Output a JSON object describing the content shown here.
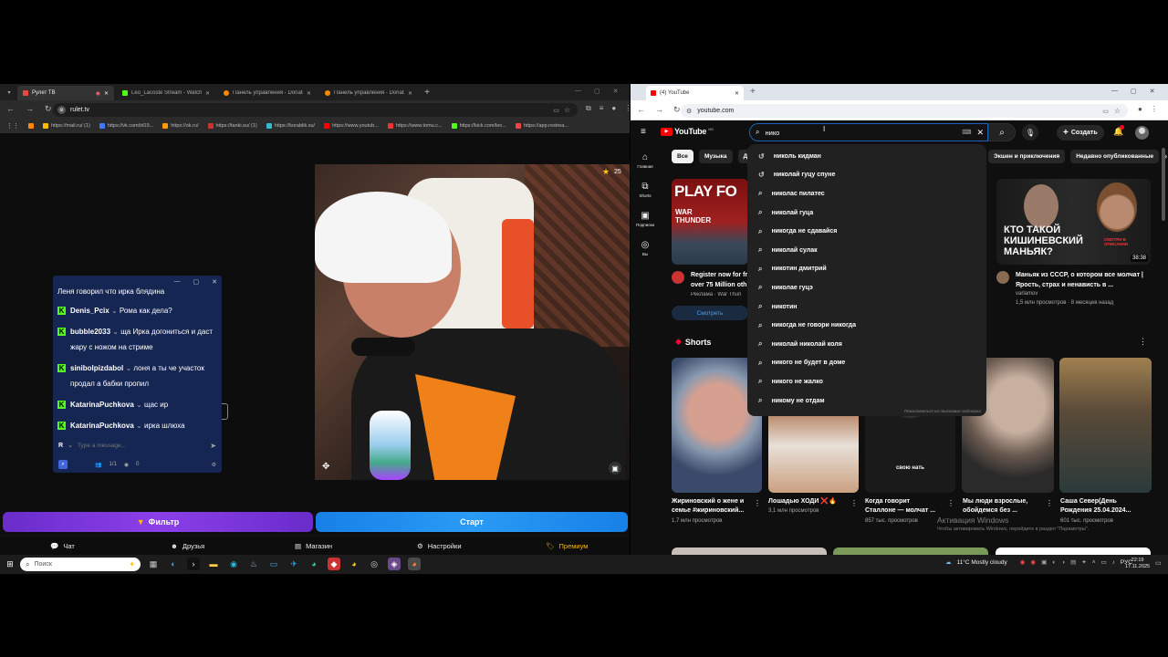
{
  "left_browser": {
    "tabs": [
      {
        "label": "Рулет ТВ",
        "active": true,
        "favicon_color": "#e44"
      },
      {
        "label": "Leo_Lacoste Stream - Watch Li",
        "favicon_color": "#53fc18"
      },
      {
        "label": "Панель управления - Donatic",
        "favicon_color": "#f80"
      },
      {
        "label": "Панель управления - Donatic",
        "favicon_color": "#f80"
      }
    ],
    "url": "rulet.tv",
    "bookmarks": [
      "https://mail.ru/ (1)",
      "https://vk.com/id19...",
      "https://ok.ru/",
      "https://tanki.su/ (1)",
      "https://korablik.su/",
      "https://www.youtub...",
      "https://www.tomu.c...",
      "https://kick.com/leo...",
      "https://app.restrea..."
    ]
  },
  "chat_widget": {
    "first_line": "Леня говорил что ирка блядина",
    "messages": [
      {
        "user": "Denis_Pcix",
        "text": "Рома как дела?"
      },
      {
        "user": "bubble2033",
        "text": "ща Ирка догониться и даст жару с ножом на стриме"
      },
      {
        "user": "sinibolpizdabol",
        "text": "лоня а ты че участок продал а бабки пропил"
      },
      {
        "user": "KatarinaPuchkova",
        "text": "щас ир"
      },
      {
        "user": "KatarinaPuchkova",
        "text": "ирка шлюха"
      }
    ],
    "input_placeholder": "Type a message...",
    "badge": "R",
    "count_label": "1/1",
    "viewers": "0"
  },
  "video": {
    "star_count": "25"
  },
  "buttons": {
    "filter": "Фильтр",
    "start": "Старт"
  },
  "bottom_nav": {
    "chat": "Чат",
    "friends": "Друзья",
    "shop": "Магазин",
    "settings": "Настройки",
    "premium": "Премиум"
  },
  "right_browser": {
    "tab_label": "(4) YouTube",
    "url": "youtube.com"
  },
  "youtube": {
    "logo": "YouTube",
    "logo_sup": "MD",
    "search_value": "нико",
    "create_label": "Создать",
    "chips": [
      "Все",
      "Музыка",
      "Дж",
      "Экшен и приключения",
      "Недавно опубликованные"
    ],
    "sidebar": [
      "Главная",
      "Shorts",
      "Подписки",
      "Вы"
    ],
    "suggestions": [
      {
        "text": "николь кидман",
        "history": true
      },
      {
        "text": "николай гуцу спуне",
        "history": true
      },
      {
        "text": "николас пилатес",
        "history": false
      },
      {
        "text": "николай гуца",
        "history": false
      },
      {
        "text": "никогда не сдавайся",
        "history": false
      },
      {
        "text": "николай сулак",
        "history": false
      },
      {
        "text": "никотин дмитрий",
        "history": false
      },
      {
        "text": "николае гуцэ",
        "history": false
      },
      {
        "text": "никотин",
        "history": false
      },
      {
        "text": "никогда не говори никогда",
        "history": false
      },
      {
        "text": "николай николай коля",
        "history": false
      },
      {
        "text": "никого не будет в доме",
        "history": false
      },
      {
        "text": "никого не жалко",
        "history": false
      },
      {
        "text": "никому не отдам",
        "history": false
      }
    ],
    "suggest_footer": "Пожаловаться на поисковые подсказки",
    "ad": {
      "thumb_text": "PLAY FO",
      "thumb_sub": "WAR THUNDER",
      "title": "Register now for fr over 75 Million oth",
      "meta": "Реклама · War Thun",
      "button": "Смотреть"
    },
    "video2": {
      "thumb_text": "КТО ТАКОЙ КИШИНЕВСКИЙ МАНЬЯК?",
      "thumb_badge": "СМОТРИ В ОПИСАНИИ",
      "duration": "38:38",
      "title": "Маньяк из СССР, о котором все молчат | Ярость, страх и ненависть в ...",
      "channel": "varlamov",
      "meta": "1,5 млн просмотров · 8 месяцев назад"
    },
    "shorts_label": "Shorts",
    "shorts": [
      {
        "title": "Жириновский о жене и семье #жириновский...",
        "views": "1,7 млн просмотров",
        "overlay": ""
      },
      {
        "title": "Лошадью ХОДИ ❌🔥",
        "views": "3,1 млн просмотров",
        "overlay": ""
      },
      {
        "title": "Когда говорит Сталлоне — молчат ...",
        "views": "857 тыс. просмотров",
        "overlay": "свою нать"
      },
      {
        "title": "Мы люди взрослые, обойдемся без ...",
        "views": "",
        "overlay": ""
      },
      {
        "title": "Саша Север(День Рождения 25.04.2024...",
        "views": "601 тыс. просмотров",
        "overlay": ""
      }
    ],
    "activation_line1": "Активация Windows",
    "activation_line2": "Чтобы активировать Windows, перейдите в раздел \"Параметры\"."
  },
  "taskbar": {
    "search_placeholder": "Поиск",
    "weather": "11°C  Mostly cloudy",
    "lang": "РУС",
    "time": "22:19",
    "date": "17.11.2025"
  }
}
